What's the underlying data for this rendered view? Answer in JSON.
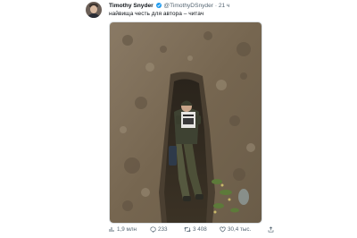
{
  "post": {
    "author_name": "Timothy Snyder",
    "author_handle": "@TimothyDSnyder",
    "separator": "·",
    "time": "21 ч",
    "text": "найвища честь для автора – читач",
    "image_alt": "soldier reading a book while lying in a trench"
  },
  "actions": {
    "views": "1,9 млн",
    "replies": "233",
    "reposts": "3 408",
    "likes": "30,4 тыс.",
    "icons": [
      "views-icon",
      "reply-icon",
      "repost-icon",
      "like-icon",
      "share-icon"
    ]
  },
  "colors": {
    "accent": "#1d9bf0",
    "secondary_text": "#536471",
    "primary_text": "#0f1419",
    "soil": "#7a6a55"
  }
}
